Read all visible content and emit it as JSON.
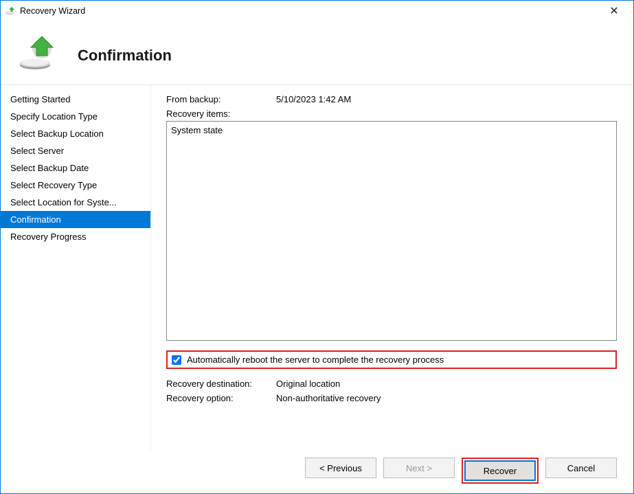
{
  "window": {
    "title": "Recovery Wizard"
  },
  "header": {
    "page_title": "Confirmation"
  },
  "sidebar": {
    "items": [
      {
        "label": "Getting Started",
        "active": false
      },
      {
        "label": "Specify Location Type",
        "active": false
      },
      {
        "label": "Select Backup Location",
        "active": false
      },
      {
        "label": "Select Server",
        "active": false
      },
      {
        "label": "Select Backup Date",
        "active": false
      },
      {
        "label": "Select Recovery Type",
        "active": false
      },
      {
        "label": "Select Location for Syste...",
        "active": false
      },
      {
        "label": "Confirmation",
        "active": true
      },
      {
        "label": "Recovery Progress",
        "active": false
      }
    ]
  },
  "main": {
    "from_backup_label": "From backup:",
    "from_backup_value": "5/10/2023 1:42 AM",
    "recovery_items_label": "Recovery items:",
    "recovery_items_content": "System state",
    "reboot_checkbox_label": "Automatically reboot the server to complete the recovery process",
    "reboot_checked": true,
    "recovery_destination_label": "Recovery destination:",
    "recovery_destination_value": "Original location",
    "recovery_option_label": "Recovery option:",
    "recovery_option_value": "Non-authoritative recovery"
  },
  "buttons": {
    "previous": "< Previous",
    "next": "Next >",
    "recover": "Recover",
    "cancel": "Cancel"
  }
}
